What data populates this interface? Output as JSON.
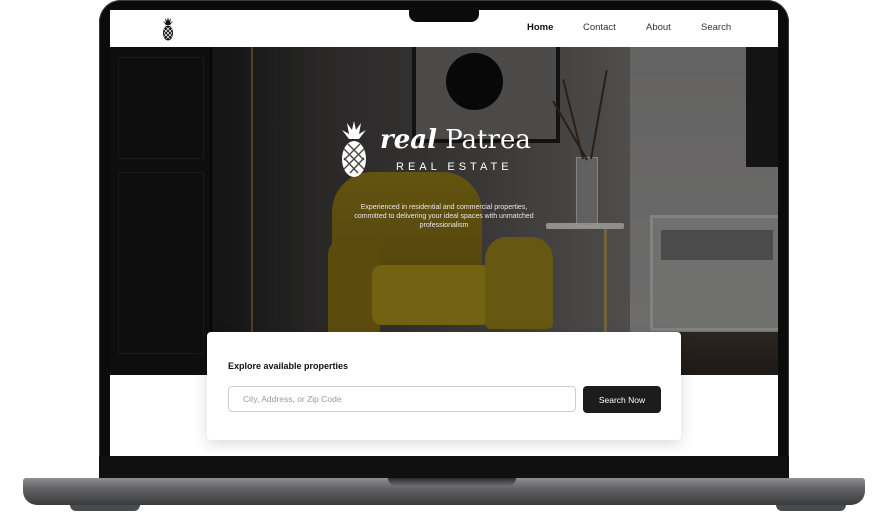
{
  "nav": {
    "links": [
      {
        "label": "Home",
        "active": true
      },
      {
        "label": "Contact",
        "active": false
      },
      {
        "label": "About",
        "active": false
      },
      {
        "label": "Search",
        "active": false
      }
    ],
    "logo_icon": "pineapple-icon"
  },
  "hero": {
    "brand_name_italic": "real",
    "brand_name_rest": "Patrea",
    "brand_subtitle": "REAL ESTATE",
    "tagline": "Experienced in residential and commercial properties, committed to delivering your ideal spaces with unmatched professionalism"
  },
  "search": {
    "title": "Explore available properties",
    "placeholder": "City, Address, or Zip Code",
    "value": "",
    "button_label": "Search Now"
  },
  "colors": {
    "button_bg": "#1c1c1c",
    "chair_yellow": "#a08818"
  }
}
